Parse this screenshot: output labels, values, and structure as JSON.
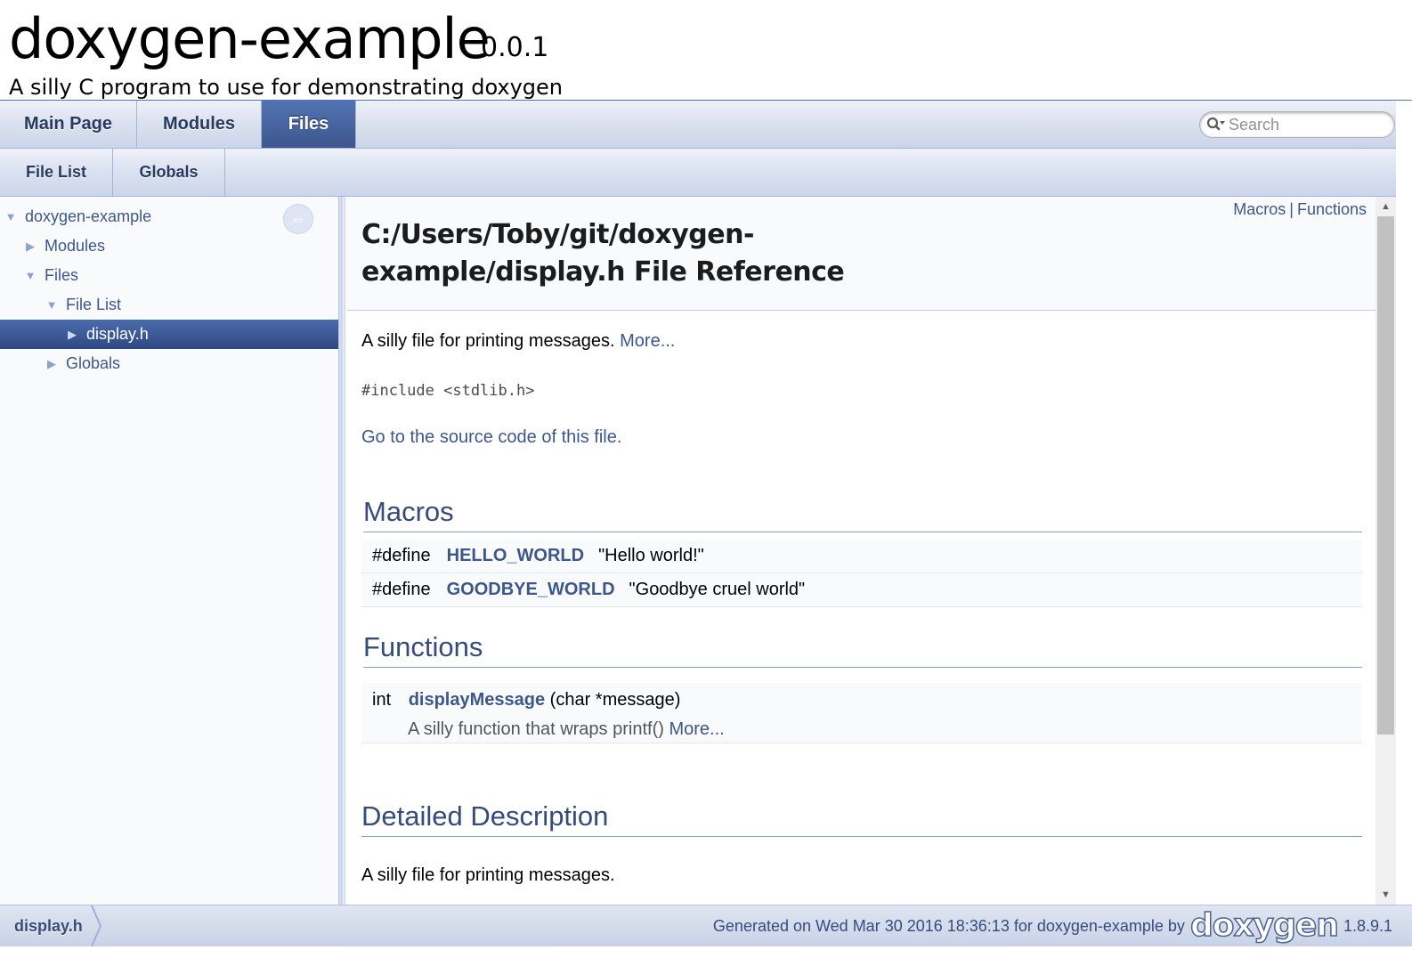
{
  "title_area": {
    "project_name": "doxygen-example",
    "project_number": "0.0.1",
    "project_brief": "A silly C program to use for demonstrating doxygen"
  },
  "tabs": {
    "primary": [
      {
        "label": "Main Page",
        "current": false
      },
      {
        "label": "Modules",
        "current": false
      },
      {
        "label": "Files",
        "current": true
      }
    ],
    "secondary": [
      {
        "label": "File List"
      },
      {
        "label": "Globals"
      }
    ],
    "search_placeholder": "Search"
  },
  "side_nav": {
    "items": [
      {
        "label": "doxygen-example",
        "arrow": "▼",
        "selected": false
      },
      {
        "label": "Modules",
        "arrow": "▶",
        "selected": false
      },
      {
        "label": "Files",
        "arrow": "▼",
        "selected": false
      },
      {
        "label": "File List",
        "arrow": "▼",
        "selected": false
      },
      {
        "label": "display.h",
        "arrow": "▶",
        "selected": true
      },
      {
        "label": "Globals",
        "arrow": "▶",
        "selected": false
      }
    ]
  },
  "header": {
    "summary_links": [
      "Macros",
      "Functions"
    ],
    "summary_separator": "|",
    "title": "C:/Users/Toby/git/doxygen-example/display.h File Reference"
  },
  "content": {
    "brief_text": "A silly file for printing messages.",
    "more_link": "More...",
    "include": "#include <stdlib.h>",
    "source_link": "Go to the source code of this file.",
    "macros_heading": "Macros",
    "macros": [
      {
        "keyword": "#define",
        "name": "HELLO_WORLD",
        "value": "\"Hello world!\""
      },
      {
        "keyword": "#define",
        "name": "GOODBYE_WORLD",
        "value": "\"Goodbye cruel world\""
      }
    ],
    "functions_heading": "Functions",
    "functions": [
      {
        "return_type": "int",
        "name": "displayMessage",
        "args": "(char *message)",
        "brief": "A silly function that wraps printf()",
        "more": "More..."
      }
    ],
    "detailed_heading": "Detailed Description",
    "detailed_text": "A silly file for printing messages."
  },
  "footer": {
    "crumb": "display.h",
    "generated_text": "Generated on Wed Mar 30 2016 18:36:13 for doxygen-example by",
    "logo_text": "doxygen",
    "version": "1.8.9.1"
  },
  "colors": {
    "link": "#3d578c",
    "current_tab": "#3d578c",
    "heading": "#354c7b"
  }
}
